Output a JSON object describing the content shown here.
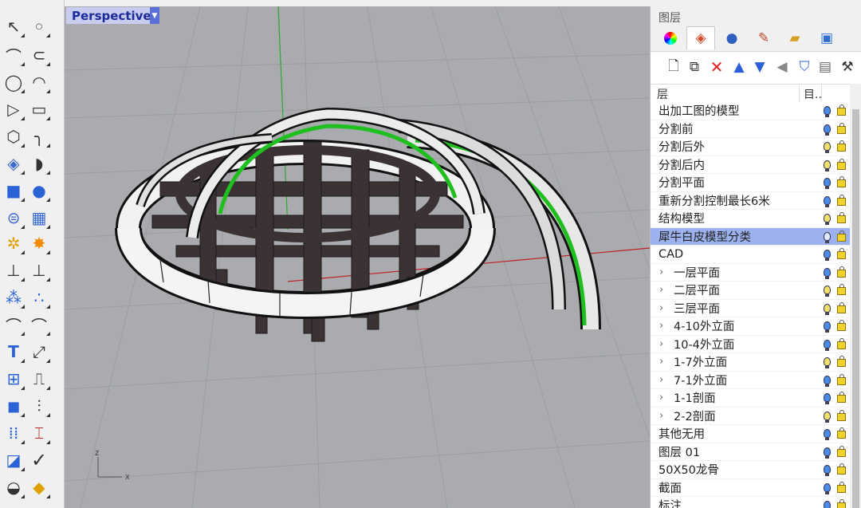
{
  "viewport": {
    "name": "Perspective",
    "axis_x": "x",
    "axis_z": "z"
  },
  "toolbar": {
    "tools": [
      "select-arrow-icon",
      "point-icon",
      "polyline-icon",
      "curve-icon",
      "circle-icon",
      "arc-icon",
      "polygon-icon",
      "rectangle-icon",
      "hexagon-icon",
      "fillet-curve-icon",
      "surface-corner-icon",
      "loft-surface-icon",
      "box-solid-icon",
      "sphere-solid-icon",
      "cylinder-mesh-icon",
      "mesh-plane-icon",
      "transform-gear-icon",
      "explode-icon",
      "boolean-icon",
      "split-icon",
      "group-icon",
      "point-cloud-icon",
      "offset-curve-icon",
      "offset-arc-icon",
      "text-icon",
      "dimension-icon",
      "block-icon",
      "analyze-icon",
      "render-icon",
      "array-icon",
      "grid-array-icon",
      "dimension-vertical-icon",
      "extrude-icon",
      "check-icon",
      "boolean-diff-icon",
      "tool-palette-icon"
    ]
  },
  "panel": {
    "title": "图层",
    "tabs": [
      "color-wheel-icon",
      "layers-icon",
      "sphere-render-icon",
      "brush-icon",
      "folder-icon",
      "display-icon"
    ],
    "tools": [
      "new-layer-icon",
      "new-sublayer-icon",
      "delete-icon",
      "move-up-icon",
      "move-down-icon",
      "collapse-icon",
      "filter-icon",
      "properties-icon",
      "tools-icon"
    ],
    "header": {
      "name": "层",
      "material": "目.."
    },
    "colors": {
      "selected": "#9cb1ee",
      "delete": "#e02020",
      "arrow": "#2a5fd8"
    },
    "layers": [
      {
        "name": "出加工图的模型",
        "child": false,
        "expandable": false,
        "selected": false,
        "bulb": "#4a8be8"
      },
      {
        "name": "分割前",
        "child": false,
        "expandable": false,
        "selected": false,
        "bulb": "#4a8be8"
      },
      {
        "name": "分割后外",
        "child": false,
        "expandable": false,
        "selected": false,
        "bulb": "#f0e06a"
      },
      {
        "name": "分割后内",
        "child": false,
        "expandable": false,
        "selected": false,
        "bulb": "#f0e06a"
      },
      {
        "name": "分割平面",
        "child": false,
        "expandable": false,
        "selected": false,
        "bulb": "#4a8be8"
      },
      {
        "name": "重新分割控制最长6米",
        "child": false,
        "expandable": false,
        "selected": false,
        "bulb": "#4a8be8"
      },
      {
        "name": "结构模型",
        "child": false,
        "expandable": false,
        "selected": false,
        "bulb": "#f0e06a"
      },
      {
        "name": "犀牛白皮模型分类",
        "child": false,
        "expandable": false,
        "selected": true,
        "bulb": "#dfe8ff"
      },
      {
        "name": "CAD",
        "child": false,
        "expandable": false,
        "selected": false,
        "bulb": "#4a8be8"
      },
      {
        "name": "一层平面",
        "child": true,
        "expandable": true,
        "selected": false,
        "bulb": "#4a8be8"
      },
      {
        "name": "二层平面",
        "child": true,
        "expandable": true,
        "selected": false,
        "bulb": "#f0e06a"
      },
      {
        "name": "三层平面",
        "child": true,
        "expandable": true,
        "selected": false,
        "bulb": "#f0e06a"
      },
      {
        "name": "4-10外立面",
        "child": true,
        "expandable": true,
        "selected": false,
        "bulb": "#4a8be8"
      },
      {
        "name": "10-4外立面",
        "child": true,
        "expandable": true,
        "selected": false,
        "bulb": "#4a8be8"
      },
      {
        "name": "1-7外立面",
        "child": true,
        "expandable": true,
        "selected": false,
        "bulb": "#f0e06a"
      },
      {
        "name": "7-1外立面",
        "child": true,
        "expandable": true,
        "selected": false,
        "bulb": "#4a8be8"
      },
      {
        "name": "1-1剖面",
        "child": true,
        "expandable": true,
        "selected": false,
        "bulb": "#4a8be8"
      },
      {
        "name": "2-2剖面",
        "child": true,
        "expandable": true,
        "selected": false,
        "bulb": "#f0e06a"
      },
      {
        "name": "其他无用",
        "child": false,
        "expandable": false,
        "selected": false,
        "bulb": "#4a8be8"
      },
      {
        "name": "图层 01",
        "child": false,
        "expandable": false,
        "selected": false,
        "bulb": "#4a8be8"
      },
      {
        "name": "50X50龙骨",
        "child": false,
        "expandable": false,
        "selected": false,
        "bulb": "#4a8be8"
      },
      {
        "name": "截面",
        "child": false,
        "expandable": false,
        "selected": false,
        "bulb": "#4a8be8"
      },
      {
        "name": "标注",
        "child": false,
        "expandable": false,
        "selected": false,
        "bulb": "#4a8be8"
      }
    ]
  }
}
